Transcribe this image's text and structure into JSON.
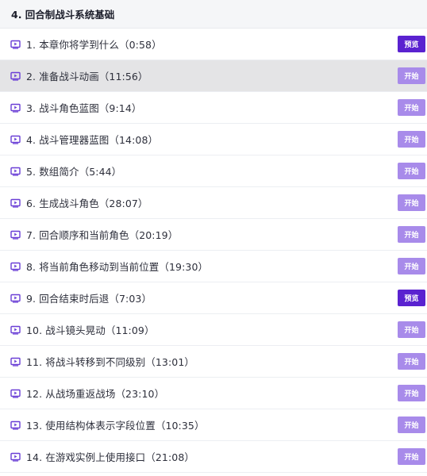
{
  "section": {
    "title": "4. 回合制战斗系统基础"
  },
  "colors": {
    "preview_button": "#5a22d0",
    "start_button": "#a88bea",
    "play_icon": "#6a3fd6",
    "active_row": "#e4e4e6"
  },
  "icons": {
    "lecture": "video-play-icon"
  },
  "lectures": [
    {
      "title": "1. 本章你将学到什么（0:58）",
      "button": "预览",
      "type": "preview",
      "active": false
    },
    {
      "title": "2. 准备战斗动画（11:56）",
      "button": "开始",
      "type": "start",
      "active": true
    },
    {
      "title": "3. 战斗角色蓝图（9:14）",
      "button": "开始",
      "type": "start",
      "active": false
    },
    {
      "title": "4. 战斗管理器蓝图（14:08）",
      "button": "开始",
      "type": "start",
      "active": false
    },
    {
      "title": "5. 数组简介（5:44）",
      "button": "开始",
      "type": "start",
      "active": false
    },
    {
      "title": "6. 生成战斗角色（28:07）",
      "button": "开始",
      "type": "start",
      "active": false
    },
    {
      "title": "7. 回合顺序和当前角色（20:19）",
      "button": "开始",
      "type": "start",
      "active": false
    },
    {
      "title": "8. 将当前角色移动到当前位置（19:30）",
      "button": "开始",
      "type": "start",
      "active": false
    },
    {
      "title": "9. 回合结束时后退（7:03）",
      "button": "预览",
      "type": "preview",
      "active": false
    },
    {
      "title": "10. 战斗镜头晃动（11:09）",
      "button": "开始",
      "type": "start",
      "active": false
    },
    {
      "title": "11. 将战斗转移到不同级别（13:01）",
      "button": "开始",
      "type": "start",
      "active": false
    },
    {
      "title": "12. 从战场重返战场（23:10）",
      "button": "开始",
      "type": "start",
      "active": false
    },
    {
      "title": "13. 使用结构体表示字段位置（10:35）",
      "button": "开始",
      "type": "start",
      "active": false
    },
    {
      "title": "14. 在游戏实例上使用接口（21:08）",
      "button": "开始",
      "type": "start",
      "active": false
    }
  ]
}
